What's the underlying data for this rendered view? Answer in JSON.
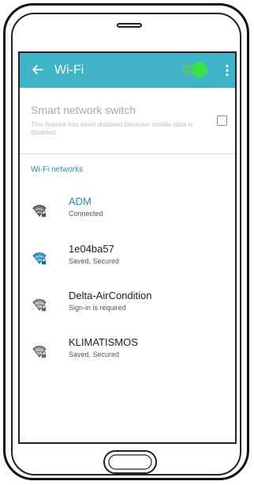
{
  "header": {
    "title": "Wi-Fi",
    "wifi_enabled": true
  },
  "smart_switch": {
    "label": "Smart network switch",
    "description": "This feature has been disabled because mobile data is disabled.",
    "checked": false
  },
  "networks_section": "Wi-Fi networks",
  "networks": [
    {
      "name": "ADM",
      "status": "Connected",
      "secured": true
    },
    {
      "name": "1e04ba57",
      "status": "Saved, Secured",
      "secured": true
    },
    {
      "name": "Delta-AirCondition",
      "status": "Sign-in is required",
      "secured": true
    },
    {
      "name": "KLIMATISMOS",
      "status": "Saved, Secured",
      "secured": true
    }
  ],
  "colors": {
    "accent": "#3fb4c9",
    "toggle_on": "#3ce04f",
    "link": "#2b88b8"
  },
  "icons": [
    "back-arrow-icon",
    "more-vert-icon",
    "wifi-lock-icon"
  ]
}
